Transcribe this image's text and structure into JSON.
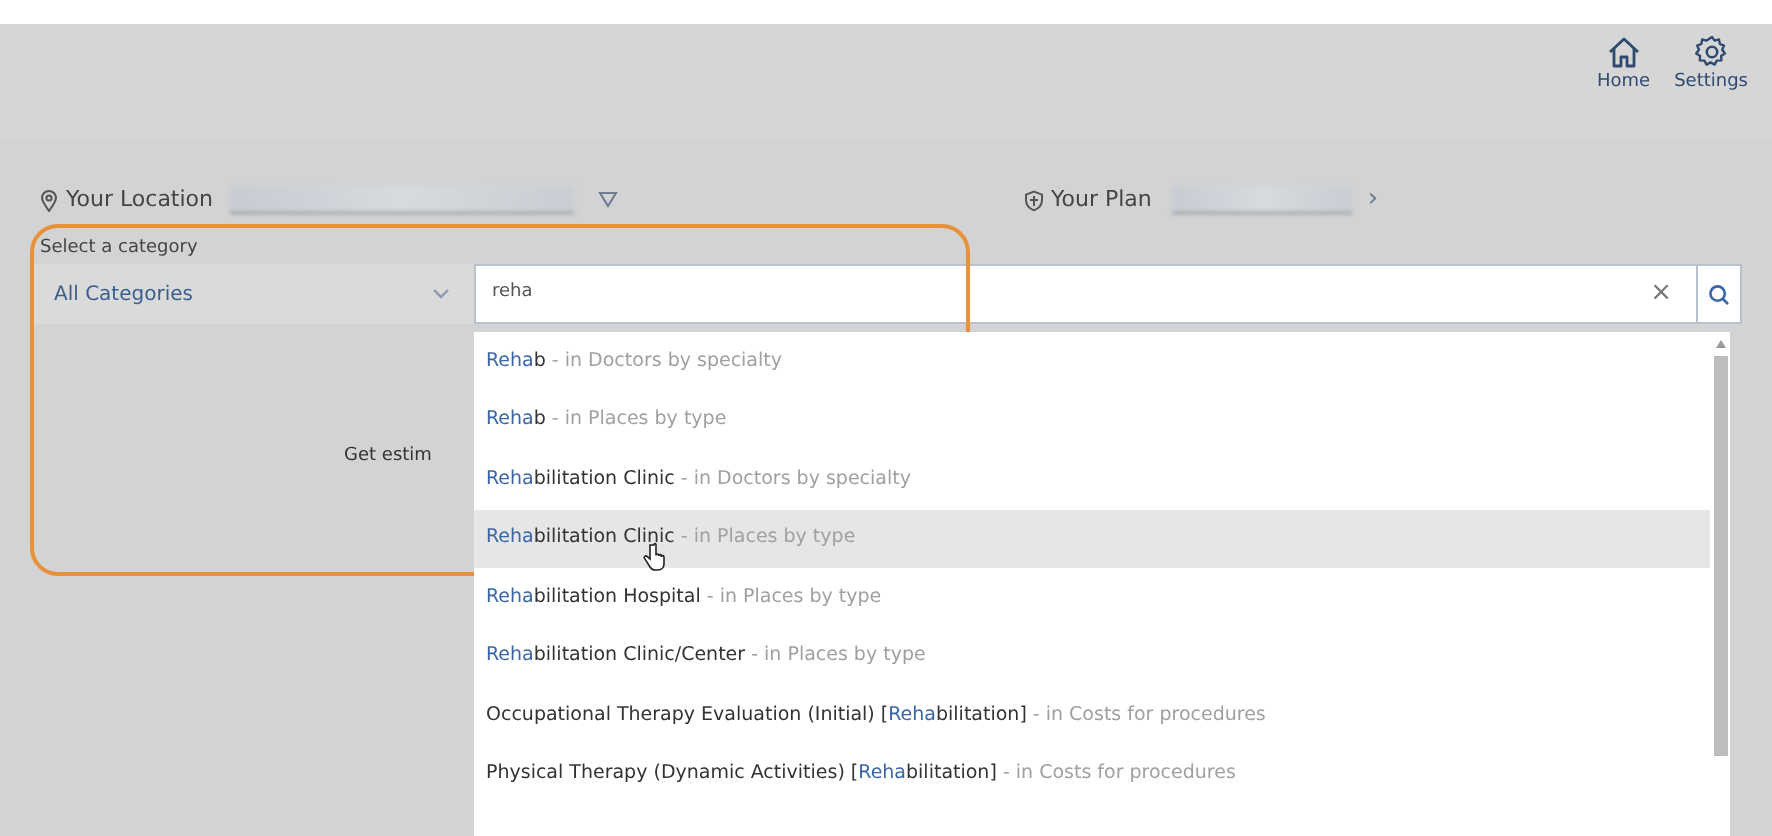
{
  "header": {
    "buttons": [
      {
        "kind": "home",
        "label": "Home"
      },
      {
        "kind": "settings",
        "label": "Settings"
      }
    ]
  },
  "location": {
    "label": "Your Location"
  },
  "plan": {
    "label": "Your Plan",
    "chevron": "›"
  },
  "category": {
    "label": "Select a category",
    "value": "All Categories"
  },
  "search": {
    "value": "reha",
    "clear": "×"
  },
  "behind_text": "Get estim",
  "suggestions": [
    {
      "match": "Reha",
      "after": "b",
      "context": "- in Doctors by specialty",
      "selected": false
    },
    {
      "match": "Reha",
      "after": "b",
      "context": "- in Places by type",
      "selected": false
    },
    {
      "match": "Reha",
      "after": "bilitation Clinic",
      "context": "- in Doctors by specialty",
      "selected": false
    },
    {
      "match": "Reha",
      "after": "bilitation Clinic",
      "context": "- in Places by type",
      "selected": true
    },
    {
      "match": "Reha",
      "after": "bilitation Hospital",
      "context": "- in Places by type",
      "selected": false
    },
    {
      "match": "Reha",
      "after": "bilitation Clinic/Center",
      "context": "- in Places by type",
      "selected": false
    },
    {
      "before": "Occupational Therapy Evaluation (Initial) [",
      "match": "Reha",
      "after": "bilitation]",
      "context": "- in Costs for procedures",
      "selected": false
    },
    {
      "before": "Physical Therapy (Dynamic Activities) [",
      "match": "Reha",
      "after": "bilitation]",
      "context": "- in Costs for procedures",
      "selected": false
    }
  ]
}
